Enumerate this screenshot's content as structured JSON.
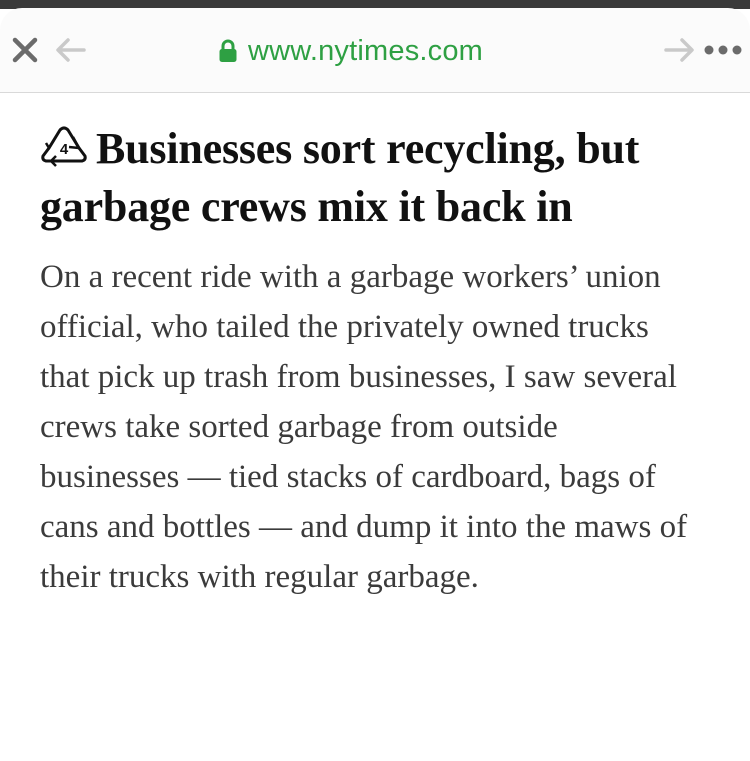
{
  "browser": {
    "url": "www.nytimes.com",
    "accent_color": "#2ea043",
    "icons": {
      "close": "close-icon",
      "back": "back-arrow-icon",
      "forward": "forward-arrow-icon",
      "more": "more-dots-icon",
      "lock": "lock-icon"
    }
  },
  "article": {
    "icon": "recycle-4-icon",
    "recycle_number": "4",
    "headline": "Businesses sort recycling, but garbage crews mix it back in",
    "summary": "On a recent ride with a garbage workers’ union official, who tailed the privately owned trucks that pick up trash from businesses, I saw several crews take sorted garbage from outside businesses — tied stacks of cardboard, bags of cans and bottles — and dump it into the maws of their trucks with regular garbage."
  }
}
